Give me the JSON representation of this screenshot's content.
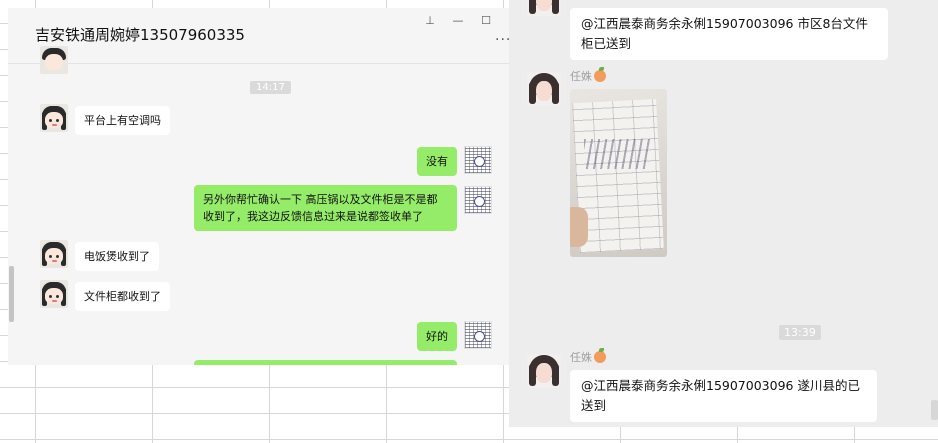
{
  "left_chat": {
    "title": "吉安铁通周婉婷13507960335",
    "window_controls": {
      "pin": "⊥",
      "minimize": "—",
      "maximize": "☐",
      "close": "✕"
    },
    "more": "···",
    "time_stamp": "14:17",
    "messages": [
      {
        "side": "in",
        "text": "平台上有空调吗"
      },
      {
        "side": "out",
        "text": "没有"
      },
      {
        "side": "out",
        "text": "另外你帮忙确认一下 高压锅以及文件柜是不是都收到了，我这边反馈信息过来是说都签收单了"
      },
      {
        "side": "in",
        "text": "电饭煲收到了"
      },
      {
        "side": "in",
        "text": "文件柜都收到了"
      },
      {
        "side": "out",
        "text": "好的"
      }
    ]
  },
  "right_chat": {
    "top_message": "@江西晨泰商务余永俐15907003096 市区8台文件柜已送到",
    "sender_name": "任姝",
    "time_stamp": "13:39",
    "bottom_message": "@江西晨泰商务余永俐15907003096 遂川县的已送到"
  }
}
